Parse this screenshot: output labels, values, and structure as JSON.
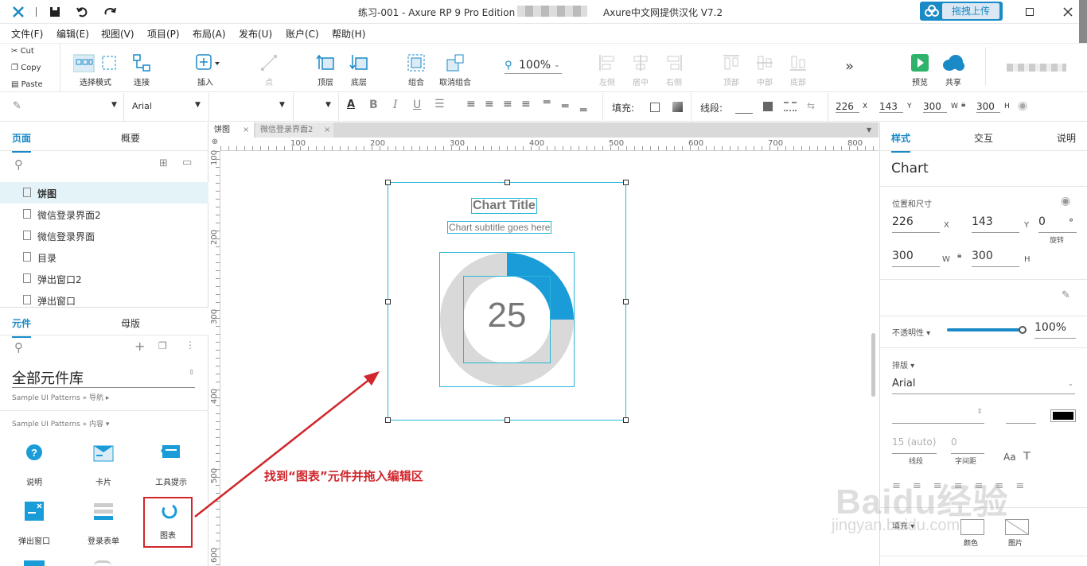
{
  "titlebar": {
    "title": "练习-001 - Axure RP 9 Pro Edition : ",
    "right_title": "Axure中文网提供汉化 V7.2",
    "upload_button": "拖拽上传"
  },
  "menu": [
    "文件(F)",
    "编辑(E)",
    "视图(V)",
    "项目(P)",
    "布局(A)",
    "发布(U)",
    "账户(C)",
    "帮助(H)"
  ],
  "clipboard": {
    "cut": "Cut",
    "copy": "Copy",
    "paste": "Paste"
  },
  "toolbar": {
    "select_mode": "选择模式",
    "connect": "连接",
    "insert": "插入",
    "point": "点",
    "top_layer": "顶层",
    "bottom_layer": "底层",
    "group": "组合",
    "ungroup": "取消组合",
    "zoom": "100%",
    "align_left": "左侧",
    "align_center": "居中",
    "align_right": "右侧",
    "align_top": "顶部",
    "align_middle": "中部",
    "align_bottom": "底部",
    "more": "»",
    "preview": "预览",
    "share": "共享"
  },
  "format": {
    "font": "Arial",
    "fill_label": "填充:",
    "stroke_label": "线段:",
    "x": "226",
    "y": "143",
    "w": "300",
    "h": "300",
    "x_label": "X",
    "y_label": "Y",
    "w_label": "W",
    "h_label": "H"
  },
  "left_panel": {
    "tab_pages": "页面",
    "tab_outline": "概要",
    "pages": [
      "饼图",
      "微信登录界面2",
      "微信登录界面",
      "目录",
      "弹出窗口2",
      "弹出窗口"
    ],
    "tab_widgets": "元件",
    "tab_masters": "母版",
    "library": "全部元件库",
    "section_nav": "Sample UI Patterns » 导航 ▸",
    "section_content": "Sample UI Patterns » 内容 ▾",
    "widgets": [
      "说明",
      "卡片",
      "工具提示",
      "弹出窗口",
      "登录表单",
      "图表"
    ]
  },
  "doc_tabs": [
    "饼图",
    "微信登录界面2"
  ],
  "ruler_top": [
    "100",
    "200",
    "300",
    "400",
    "500",
    "600",
    "700",
    "800"
  ],
  "ruler_left": [
    "100",
    "200",
    "300",
    "400",
    "500",
    "600"
  ],
  "canvas": {
    "chart_title": "Chart Title",
    "chart_subtitle": "Chart subtitle goes here",
    "chart_value": "25",
    "annotation": "找到“图表”元件并拖入编辑区"
  },
  "chart_data": {
    "type": "pie",
    "values": [
      25,
      75
    ],
    "colors": [
      "#1a9cd8",
      "#d9d9d9"
    ],
    "title": "Chart Title",
    "subtitle": "Chart subtitle goes here"
  },
  "right_panel": {
    "tab_style": "样式",
    "tab_interaction": "交互",
    "tab_notes": "说明",
    "widget_name": "Chart",
    "pos_size_label": "位置和尺寸",
    "x": "226",
    "y": "143",
    "rotation": "0",
    "rotation_unit": "°",
    "rotation_label": "旋转",
    "w": "300",
    "h": "300",
    "x_label": "X",
    "y_label": "Y",
    "w_label": "W",
    "h_label": "H",
    "opacity_label": "不透明性 ▾",
    "opacity": "100%",
    "opacity_value": 1.0,
    "typography_label": "排版 ▾",
    "font": "Arial",
    "line_height": "15 (auto)",
    "line_height_label": "线段",
    "letter_spacing": "0",
    "letter_spacing_label": "字间距",
    "fill_label": "填充 ▾",
    "fill_color_label": "颜色",
    "fill_image_label": "图片"
  },
  "watermark": {
    "brand": "Baidu经验",
    "url": "jingyan.baidu.com"
  },
  "colors": {
    "accent": "#1a8ac7",
    "chart_fill": "#1a9cd8",
    "annotation": "#d0262c",
    "selection": "#2ab5d8"
  }
}
